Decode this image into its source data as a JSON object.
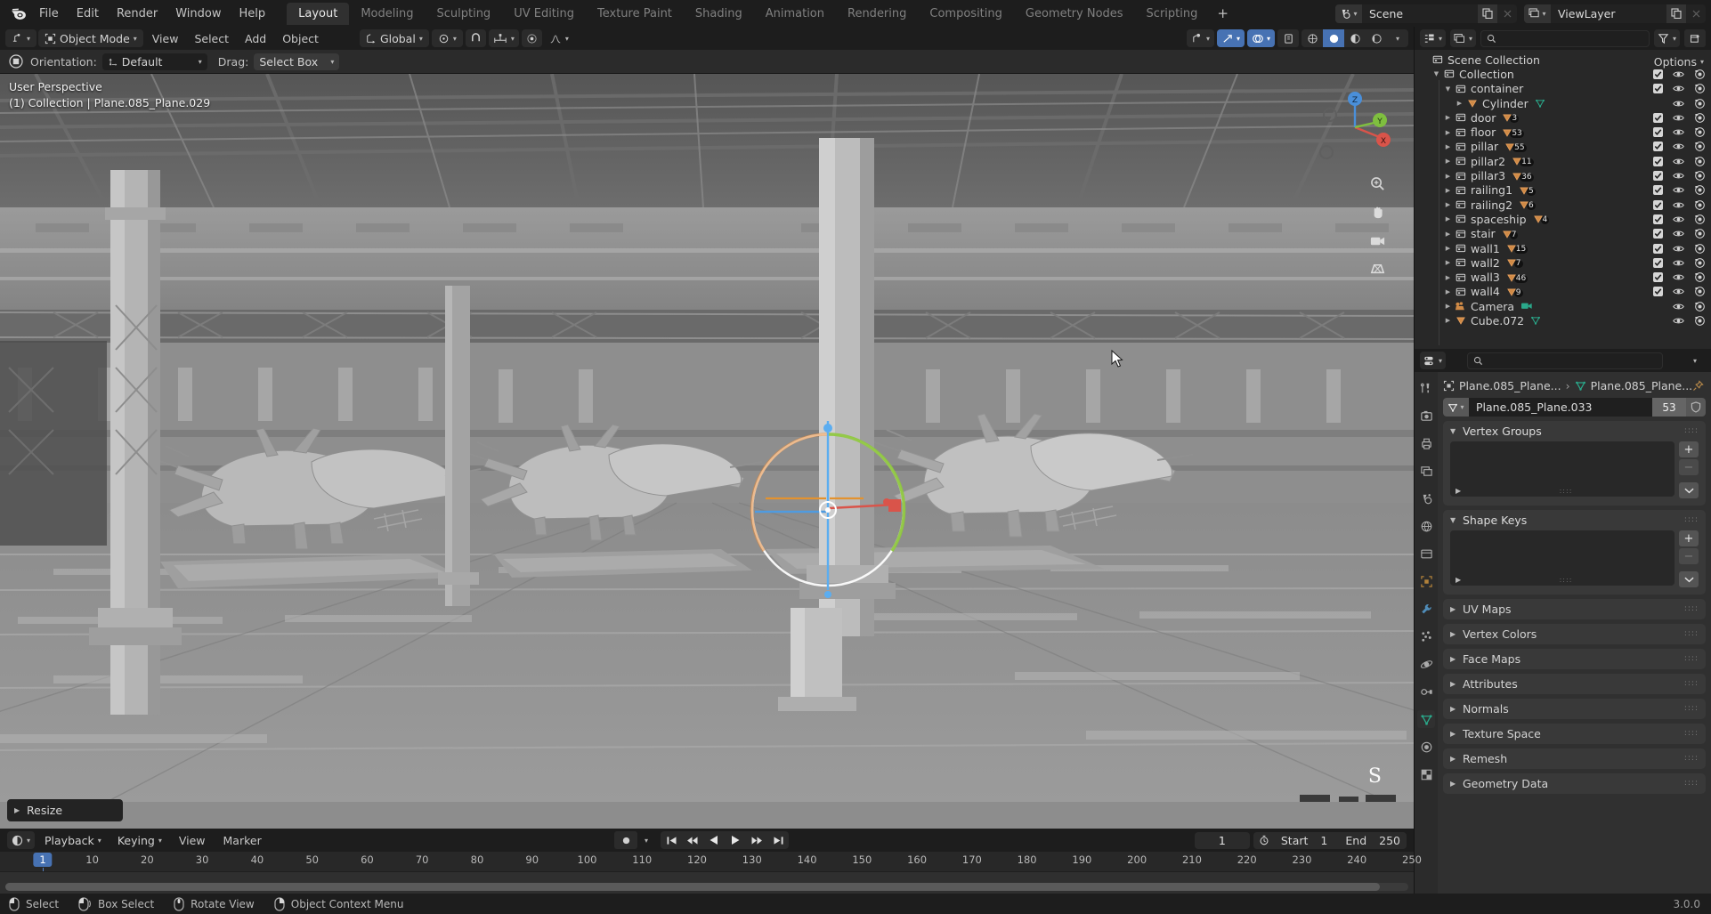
{
  "app": {
    "name": "Blender",
    "version": "3.0.0",
    "logo_icon": "blender-logo-icon"
  },
  "topbar": {
    "menus": [
      "File",
      "Edit",
      "Render",
      "Window",
      "Help"
    ],
    "workspace_tabs": [
      {
        "label": "Layout",
        "active": true
      },
      {
        "label": "Modeling",
        "active": false
      },
      {
        "label": "Sculpting",
        "active": false
      },
      {
        "label": "UV Editing",
        "active": false
      },
      {
        "label": "Texture Paint",
        "active": false
      },
      {
        "label": "Shading",
        "active": false
      },
      {
        "label": "Animation",
        "active": false
      },
      {
        "label": "Rendering",
        "active": false
      },
      {
        "label": "Compositing",
        "active": false
      },
      {
        "label": "Geometry Nodes",
        "active": false
      },
      {
        "label": "Scripting",
        "active": false
      }
    ],
    "add_workspace_label": "+",
    "scene": {
      "icon": "scene-icon",
      "name": "Scene",
      "new_icon": "duplicate-icon",
      "unlink_icon": "x-icon"
    },
    "view_layer": {
      "icon": "view-layer-icon",
      "name": "ViewLayer",
      "new_icon": "duplicate-icon",
      "unlink_icon": "x-icon"
    }
  },
  "viewport_header": {
    "editor_type_icon": "editor-type-3dview-icon",
    "mode": "Object Mode",
    "mode_icon": "object-mode-icon",
    "menus": [
      "View",
      "Select",
      "Add",
      "Object"
    ],
    "transform_orientation": "Global",
    "transform_orientation_icon": "orientation-icon",
    "pivot_icon": "pivot-point-icon",
    "snap_icon": "snap-magnet-icon",
    "snap_target_icon": "snap-increment-icon",
    "proportional_icon": "proportional-edit-icon",
    "proportional_falloff_icon": "falloff-curve-icon",
    "right_controls": [
      {
        "name": "visibility-selector",
        "active": false
      },
      {
        "name": "gizmo-toggle",
        "active": true
      },
      {
        "name": "overlays-toggle",
        "active": true
      },
      {
        "name": "xray-toggle",
        "active": false
      },
      {
        "name": "shading-wireframe",
        "active": false
      },
      {
        "name": "shading-solid",
        "active": true
      },
      {
        "name": "shading-material",
        "active": false
      },
      {
        "name": "shading-rendered",
        "active": false
      }
    ]
  },
  "tool_settings": {
    "active_tool_icon": "select-box-tool-icon",
    "orientation_label": "Orientation:",
    "orientation_value": "Default",
    "drag_label": "Drag:",
    "drag_value": "Select Box",
    "options_label": "Options"
  },
  "viewport": {
    "overlay_line1": "User Perspective",
    "overlay_line2": "(1) Collection | Plane.085_Plane.029",
    "gizmo_axes": [
      "X",
      "Y",
      "Z"
    ],
    "operator_panel": "Resize",
    "modal_key_hint": "S",
    "nav_buttons": [
      "zoom-icon",
      "pan-hand-icon",
      "camera-view-icon",
      "perspective-toggle-icon"
    ]
  },
  "timeline": {
    "editor_icon": "timeline-editor-icon",
    "menus": [
      "Playback",
      "Keying",
      "View",
      "Marker"
    ],
    "record_icon": "auto-keying-icon",
    "transport": [
      "jump-to-start-icon",
      "jump-prev-keyframe-icon",
      "play-reverse-icon",
      "play-icon",
      "jump-next-keyframe-icon",
      "jump-to-end-icon"
    ],
    "current_frame": "1",
    "current_frame_icon": "stopwatch-icon",
    "start_label": "Start",
    "start_value": "1",
    "end_label": "End",
    "end_value": "250",
    "ticks": [
      10,
      20,
      30,
      40,
      50,
      60,
      70,
      80,
      90,
      100,
      110,
      120,
      130,
      140,
      150,
      160,
      170,
      180,
      190,
      200,
      210,
      220,
      230,
      240,
      250
    ],
    "playhead_frame": 1
  },
  "outliner": {
    "display_mode_icon": "outliner-display-mode-icon",
    "filter_id_icon": "outliner-id-filter-icon",
    "search_placeholder": "",
    "search_icon": "search-icon",
    "filter_icon": "funnel-filter-icon",
    "new_collection_icon": "new-collection-icon",
    "rows": [
      {
        "name": "Scene Collection",
        "icon": "collection-icon",
        "indent": 0,
        "disclosure": "",
        "checkbox": false,
        "eye": false,
        "camera": false,
        "count": null,
        "subicon": null
      },
      {
        "name": "Collection",
        "icon": "collection-icon",
        "indent": 1,
        "disclosure": "down",
        "checkbox": true,
        "eye": true,
        "camera": true,
        "count": null,
        "subicon": null
      },
      {
        "name": "container",
        "icon": "collection-icon",
        "indent": 2,
        "disclosure": "down",
        "checkbox": true,
        "eye": true,
        "camera": true,
        "count": null,
        "subicon": null
      },
      {
        "name": "Cylinder",
        "icon": "mesh-object-icon",
        "indent": 3,
        "disclosure": "right",
        "checkbox": false,
        "eye": true,
        "camera": true,
        "count": null,
        "subicon": "mesh-data-icon"
      },
      {
        "name": "door",
        "icon": "collection-icon",
        "indent": 2,
        "disclosure": "right",
        "checkbox": true,
        "eye": true,
        "camera": true,
        "count": "3",
        "subicon": "mesh-object-icon"
      },
      {
        "name": "floor",
        "icon": "collection-icon",
        "indent": 2,
        "disclosure": "right",
        "checkbox": true,
        "eye": true,
        "camera": true,
        "count": "53",
        "subicon": "mesh-object-icon"
      },
      {
        "name": "pillar",
        "icon": "collection-icon",
        "indent": 2,
        "disclosure": "right",
        "checkbox": true,
        "eye": true,
        "camera": true,
        "count": "55",
        "subicon": "mesh-object-icon"
      },
      {
        "name": "pillar2",
        "icon": "collection-icon",
        "indent": 2,
        "disclosure": "right",
        "checkbox": true,
        "eye": true,
        "camera": true,
        "count": "11",
        "subicon": "mesh-object-icon"
      },
      {
        "name": "pillar3",
        "icon": "collection-icon",
        "indent": 2,
        "disclosure": "right",
        "checkbox": true,
        "eye": true,
        "camera": true,
        "count": "36",
        "subicon": "mesh-object-icon"
      },
      {
        "name": "railing1",
        "icon": "collection-icon",
        "indent": 2,
        "disclosure": "right",
        "checkbox": true,
        "eye": true,
        "camera": true,
        "count": "5",
        "subicon": "mesh-object-icon"
      },
      {
        "name": "railing2",
        "icon": "collection-icon",
        "indent": 2,
        "disclosure": "right",
        "checkbox": true,
        "eye": true,
        "camera": true,
        "count": "6",
        "subicon": "mesh-object-icon"
      },
      {
        "name": "spaceship",
        "icon": "collection-icon",
        "indent": 2,
        "disclosure": "right",
        "checkbox": true,
        "eye": true,
        "camera": true,
        "count": "4",
        "subicon": "mesh-object-icon"
      },
      {
        "name": "stair",
        "icon": "collection-icon",
        "indent": 2,
        "disclosure": "right",
        "checkbox": true,
        "eye": true,
        "camera": true,
        "count": "7",
        "subicon": "mesh-object-icon"
      },
      {
        "name": "wall1",
        "icon": "collection-icon",
        "indent": 2,
        "disclosure": "right",
        "checkbox": true,
        "eye": true,
        "camera": true,
        "count": "15",
        "subicon": "mesh-object-icon"
      },
      {
        "name": "wall2",
        "icon": "collection-icon",
        "indent": 2,
        "disclosure": "right",
        "checkbox": true,
        "eye": true,
        "camera": true,
        "count": "7",
        "subicon": "mesh-object-icon"
      },
      {
        "name": "wall3",
        "icon": "collection-icon",
        "indent": 2,
        "disclosure": "right",
        "checkbox": true,
        "eye": true,
        "camera": true,
        "count": "46",
        "subicon": "mesh-object-icon"
      },
      {
        "name": "wall4",
        "icon": "collection-icon",
        "indent": 2,
        "disclosure": "right",
        "checkbox": true,
        "eye": true,
        "camera": true,
        "count": "9",
        "subicon": "mesh-object-icon"
      },
      {
        "name": "Camera",
        "icon": "camera-object-icon",
        "indent": 2,
        "disclosure": "right",
        "checkbox": false,
        "eye": true,
        "camera": true,
        "count": null,
        "subicon": "camera-data-icon"
      },
      {
        "name": "Cube.072",
        "icon": "mesh-object-icon",
        "indent": 2,
        "disclosure": "right",
        "checkbox": false,
        "eye": true,
        "camera": true,
        "count": null,
        "subicon": "mesh-data-icon"
      }
    ]
  },
  "properties": {
    "editor_icon": "properties-editor-icon",
    "search_placeholder": "",
    "search_icon": "search-icon",
    "options_caret": "chevron-down-icon",
    "tabs": [
      {
        "name": "tool-tab",
        "icon": "tool-icon",
        "active": false
      },
      {
        "name": "render-tab",
        "icon": "render-camera-back-icon",
        "active": false
      },
      {
        "name": "output-tab",
        "icon": "printer-icon",
        "active": false
      },
      {
        "name": "view-layer-tab",
        "icon": "images-icon",
        "active": false
      },
      {
        "name": "scene-tab",
        "icon": "scene-cone-icon",
        "active": false
      },
      {
        "name": "world-tab",
        "icon": "world-globe-icon",
        "active": false
      },
      {
        "name": "collection-tab",
        "icon": "collection-box-icon",
        "active": false
      },
      {
        "name": "object-tab",
        "icon": "object-square-icon",
        "active": false
      },
      {
        "name": "modifier-tab",
        "icon": "wrench-icon",
        "active": false
      },
      {
        "name": "particles-tab",
        "icon": "particles-icon",
        "active": false
      },
      {
        "name": "physics-tab",
        "icon": "physics-orbit-icon",
        "active": false
      },
      {
        "name": "constraints-tab",
        "icon": "constraints-icon",
        "active": false
      },
      {
        "name": "data-tab",
        "icon": "mesh-data-triangle-icon",
        "active": true
      },
      {
        "name": "material-tab",
        "icon": "material-sphere-icon",
        "active": false
      },
      {
        "name": "texture-tab",
        "icon": "texture-checker-icon",
        "active": false
      }
    ],
    "breadcrumb": {
      "object_icon": "object-square-icon",
      "object_name": "Plane.085_Plane...",
      "separator": "›",
      "data_icon": "mesh-data-triangle-icon",
      "data_name": "Plane.085_Plane...",
      "pin_icon": "pin-icon"
    },
    "datablock": {
      "icon": "mesh-data-triangle-icon",
      "name": "Plane.085_Plane.033",
      "users": "53",
      "fake_user_icon": "shield-icon"
    },
    "panels": [
      {
        "label": "Vertex Groups",
        "open": true,
        "type": "list",
        "grip": "::::"
      },
      {
        "label": "Shape Keys",
        "open": true,
        "type": "list",
        "grip": "::::"
      },
      {
        "label": "UV Maps",
        "open": false,
        "type": "row",
        "grip": "::::"
      },
      {
        "label": "Vertex Colors",
        "open": false,
        "type": "row",
        "grip": "::::"
      },
      {
        "label": "Face Maps",
        "open": false,
        "type": "row",
        "grip": "::::"
      },
      {
        "label": "Attributes",
        "open": false,
        "type": "row",
        "grip": "::::"
      },
      {
        "label": "Normals",
        "open": false,
        "type": "row",
        "grip": "::::"
      },
      {
        "label": "Texture Space",
        "open": false,
        "type": "row",
        "grip": "::::"
      },
      {
        "label": "Remesh",
        "open": false,
        "type": "row",
        "grip": "::::"
      },
      {
        "label": "Geometry Data",
        "open": false,
        "type": "row",
        "grip": "::::"
      }
    ],
    "list_add_label": "+",
    "list_remove_label": "−",
    "list_menu_icon": "chevron-down-icon"
  },
  "statusbar": {
    "items": [
      {
        "icon": "mouse-left-icon",
        "label": "Select"
      },
      {
        "icon": "mouse-left-drag-icon",
        "label": "Box Select"
      },
      {
        "icon": "mouse-middle-icon",
        "label": "Rotate View"
      },
      {
        "icon": "mouse-right-icon",
        "label": "Object Context Menu"
      }
    ],
    "version": "3.0.0"
  },
  "colors": {
    "accent_blue": "#4772b3",
    "header_bg": "#1d1d1d",
    "panel_bg": "#303030",
    "editor_bg": "#282828",
    "axis_x": "#d9544a",
    "axis_y": "#7fbf3f",
    "axis_z": "#4a8fd9"
  }
}
